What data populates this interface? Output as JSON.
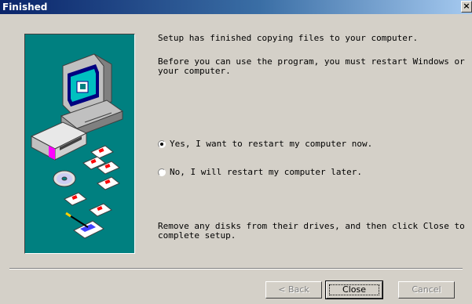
{
  "window": {
    "title": "Finished",
    "close_glyph": "×"
  },
  "message": {
    "line1": "Setup has finished copying files to your computer.",
    "line2": "Before you can use the program, you must restart Windows or\nyour computer.",
    "line3": "Remove any disks from their drives, and then click Close to\ncomplete setup."
  },
  "options": {
    "restart_now": {
      "label": "Yes, I want to restart my computer now.",
      "selected": true
    },
    "restart_later": {
      "label": "No, I will restart my computer later.",
      "selected": false
    }
  },
  "buttons": {
    "back": "< Back",
    "close": "Close",
    "cancel": "Cancel"
  },
  "colors": {
    "title_bar": "#0a246a",
    "art_background": "#008080",
    "face": "#d4d0c8"
  },
  "icons": [
    "computer-icon",
    "disk-drive-icon",
    "floppy-disk-icon",
    "cd-rom-icon",
    "pen-card-icon"
  ]
}
